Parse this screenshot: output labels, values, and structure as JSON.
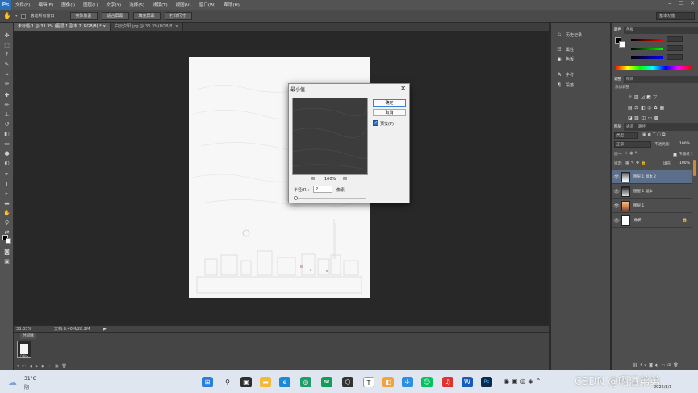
{
  "app": {
    "logo": "Ps",
    "menu": [
      "文件(F)",
      "编辑(E)",
      "图像(I)",
      "图层(L)",
      "文字(Y)",
      "选择(S)",
      "滤镜(T)",
      "视图(V)",
      "窗口(W)",
      "帮助(H)"
    ],
    "window_controls": [
      "–",
      "☐",
      "✕"
    ]
  },
  "options_bar": {
    "checkbox_label": "滚动所有窗口",
    "buttons": [
      "实际像素",
      "适合屏幕",
      "填充屏幕",
      "打印尺寸"
    ],
    "workspace": "基本功能"
  },
  "tabs": [
    {
      "label": "未标题-1 @ 33.3% (图层 1 副本 2, RGB/8) *",
      "close": "×",
      "active": true
    },
    {
      "label": "白云夕阳.jpg @ 33.3%(RGB/8)",
      "close": "×",
      "active": false
    }
  ],
  "status": {
    "zoom": "33.33%",
    "doc": "文档:8.40M/28.2M",
    "arrow": "▶"
  },
  "timeline": {
    "tab": "时间轴",
    "frame_time": "0 秒▾"
  },
  "icon_strip": {
    "items": [
      {
        "label": "历史记录",
        "icon": "history-icon"
      },
      {
        "label": "属性",
        "icon": "properties-icon"
      },
      {
        "label": "色板",
        "icon": "swatches-icon"
      },
      {
        "label": "字符",
        "icon": "character-icon"
      },
      {
        "label": "段落",
        "icon": "paragraph-icon"
      }
    ]
  },
  "color_panel": {
    "tabs": [
      "颜色",
      "色板"
    ]
  },
  "adjust_panel": {
    "tabs": [
      "调整",
      "样式"
    ],
    "title": "添加调整"
  },
  "layers_panel": {
    "tabs": [
      "图层",
      "通道",
      "路径"
    ],
    "kind": "类型",
    "blend_mode": "正常",
    "opacity_label": "不透明度:",
    "opacity": "100%",
    "lock_label": "锁定:",
    "fill_label": "填充:",
    "fill": "100%",
    "propagate": "传播帧 1",
    "unify": "统一:",
    "layers": [
      {
        "name": "图层 1 副本 2",
        "selected": true
      },
      {
        "name": "图层 1 副本",
        "selected": false
      },
      {
        "name": "图层 1",
        "selected": false
      },
      {
        "name": "背景",
        "selected": false
      }
    ]
  },
  "dialog": {
    "title": "最小值",
    "close": "✕",
    "ok": "确定",
    "cancel": "取消",
    "preview_label": "预览(P)",
    "preview_checked": true,
    "zoom": "100%",
    "zoom_out": "⊟",
    "zoom_in": "⊞",
    "radius_label": "半径(R):",
    "radius_value": "2",
    "radius_unit": "像素",
    "slider_fraction": 0.02
  },
  "taskbar": {
    "weather_temp": "31°C",
    "weather_desc": "阴",
    "watermark": "CSDN @啊酒弟弟",
    "date": "2022/8/1"
  }
}
